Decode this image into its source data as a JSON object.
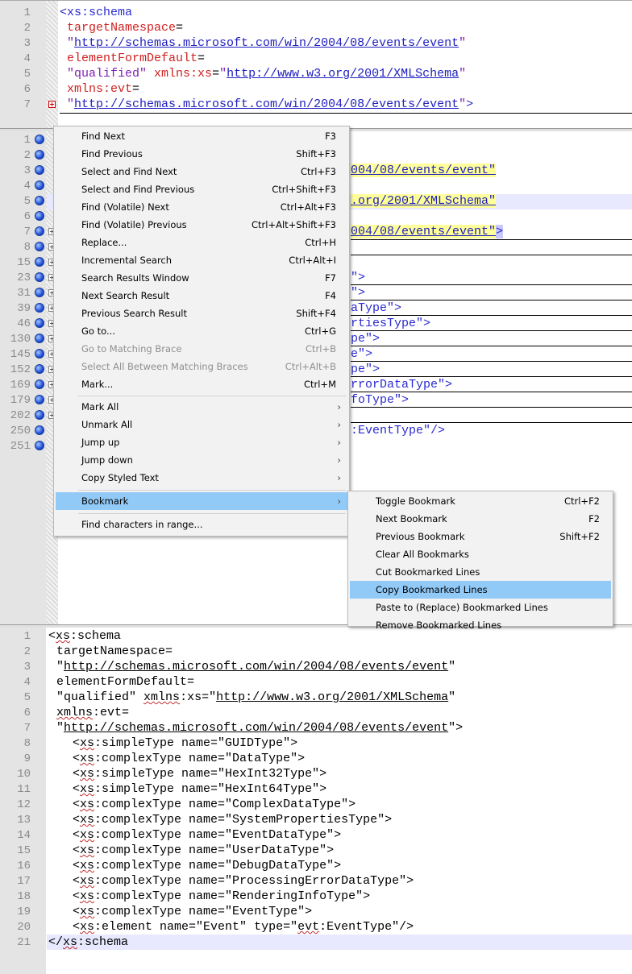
{
  "pane1": {
    "line_numbers": [
      "1",
      "2",
      "3",
      "4",
      "5",
      "6",
      "7"
    ]
  },
  "pane2": {
    "line_numbers": [
      "1",
      "2",
      "3",
      "4",
      "5",
      "6",
      "7",
      "8",
      "15",
      "23",
      "31",
      "39",
      "46",
      "130",
      "145",
      "152",
      "169",
      "179",
      "202",
      "250",
      "251"
    ],
    "visible_fragments": {
      "l3": "004/08/events/event\"",
      "l5": ".org/2001/XMLSchema\"",
      "l7a": "004/08/events/event\"",
      "l7b": ">",
      "l23": "\">",
      "l31": "\">",
      "l39": "aType\">",
      "l46": "rtiesType\">",
      "l130": "pe\">",
      "l145": "e\">",
      "l152": "pe\">",
      "l169": "rrorDataType\">",
      "l179": "foType\">",
      "l250": ":EventType\"/>"
    }
  },
  "pane3": {
    "line_numbers": [
      "1",
      "2",
      "3",
      "4",
      "5",
      "6",
      "7",
      "8",
      "9",
      "10",
      "11",
      "12",
      "13",
      "14",
      "15",
      "16",
      "17",
      "18",
      "19",
      "20",
      "21"
    ]
  },
  "xml": {
    "open_tag": "<xs:schema",
    "open_bracket": "<",
    "xs": "xs",
    "colon_schema": ":schema",
    "target_ns": "targetNamespace",
    "element_form": "elementFormDefault",
    "eq": "=",
    "qualified": "\"qualified\"",
    "xmlns_xs_attr": "xmlns:xs",
    "xmlns": "xmlns",
    "colon_xs": ":xs",
    "colon_evt": ":evt",
    "evt": "evt",
    "xmlns_evt_attr": "xmlns:evt",
    "quote": "\"",
    "events_url": "http://schemas.microsoft.com/win/2004/08/events/event",
    "schema_url": "http://www.w3.org/2001/XMLSchema",
    "close_bracket": ">",
    "close_tag_open": "</",
    "simple_type": ":simpleType name=\"GUIDType\">",
    "rows": [
      ":complexType name=\"DataType\">",
      ":simpleType name=\"HexInt32Type\">",
      ":simpleType name=\"HexInt64Type\">",
      ":complexType name=\"ComplexDataType\">",
      ":complexType name=\"SystemPropertiesType\">",
      ":complexType name=\"EventDataType\">",
      ":complexType name=\"UserDataType\">",
      ":complexType name=\"DebugDataType\">",
      ":complexType name=\"ProcessingErrorDataType\">",
      ":complexType name=\"RenderingInfoType\">",
      ":complexType name=\"EventType\">"
    ],
    "element_pre": ":element name=\"Event\" type=\"",
    "element_post": ":EventType\"/>"
  },
  "context_menu": {
    "items": [
      {
        "label": "Find Next",
        "shortcut": "F3"
      },
      {
        "label": "Find Previous",
        "shortcut": "Shift+F3"
      },
      {
        "label": "Select and Find Next",
        "shortcut": "Ctrl+F3"
      },
      {
        "label": "Select and Find Previous",
        "shortcut": "Ctrl+Shift+F3"
      },
      {
        "label": "Find (Volatile) Next",
        "shortcut": "Ctrl+Alt+F3"
      },
      {
        "label": "Find (Volatile) Previous",
        "shortcut": "Ctrl+Alt+Shift+F3"
      },
      {
        "label": "Replace...",
        "shortcut": "Ctrl+H"
      },
      {
        "label": "Incremental Search",
        "shortcut": "Ctrl+Alt+I"
      },
      {
        "label": "Search Results Window",
        "shortcut": "F7"
      },
      {
        "label": "Next Search Result",
        "shortcut": "F4"
      },
      {
        "label": "Previous Search Result",
        "shortcut": "Shift+F4"
      },
      {
        "label": "Go to...",
        "shortcut": "Ctrl+G"
      },
      {
        "label": "Go to Matching Brace",
        "shortcut": "Ctrl+B"
      },
      {
        "label": "Select All Between Matching Braces",
        "shortcut": "Ctrl+Alt+B"
      },
      {
        "label": "Mark...",
        "shortcut": "Ctrl+M"
      }
    ],
    "submenu_items": [
      "Mark All",
      "Unmark All",
      "Jump up",
      "Jump down",
      "Copy Styled Text"
    ],
    "bookmark": "Bookmark",
    "find_chars": "Find characters in range...",
    "arrow": "›"
  },
  "bookmark_submenu": {
    "items": [
      {
        "label": "Toggle Bookmark",
        "shortcut": "Ctrl+F2"
      },
      {
        "label": "Next Bookmark",
        "shortcut": "F2"
      },
      {
        "label": "Previous Bookmark",
        "shortcut": "Shift+F2"
      },
      {
        "label": "Clear All Bookmarks",
        "shortcut": ""
      },
      {
        "label": "Cut Bookmarked Lines",
        "shortcut": ""
      },
      {
        "label": "Copy Bookmarked Lines",
        "shortcut": ""
      },
      {
        "label": "Paste to (Replace) Bookmarked Lines",
        "shortcut": ""
      },
      {
        "label": "Remove Bookmarked Lines",
        "shortcut": ""
      }
    ]
  },
  "colors": {
    "tag": "#2a2ad0",
    "attribute": "#d02020",
    "value": "#8020b0",
    "menu_highlight": "#91c9f7"
  }
}
